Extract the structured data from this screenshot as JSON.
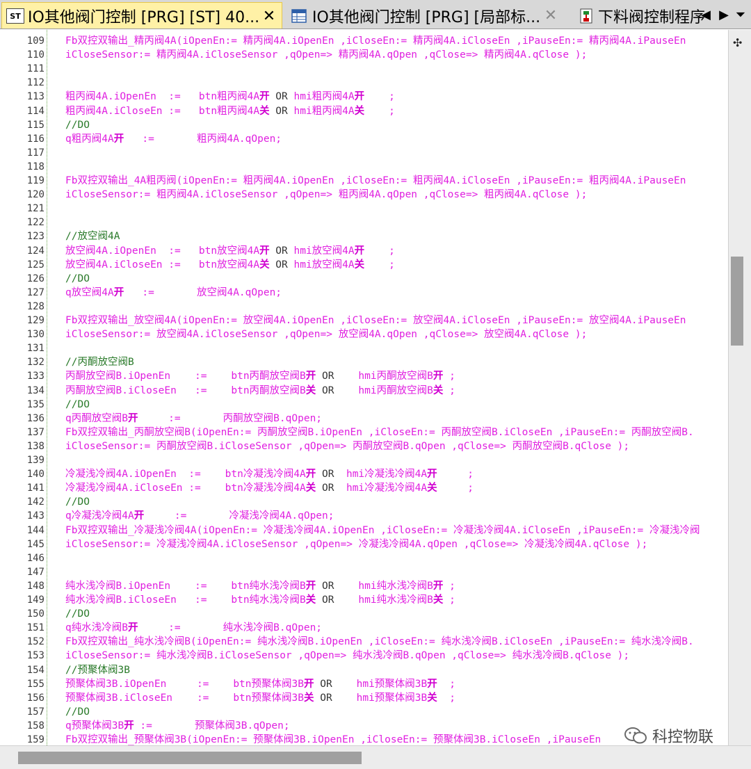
{
  "tabs": [
    {
      "title": "IO其他阀门控制 [PRG] [ST] 40...",
      "badge": "ST",
      "active": true
    },
    {
      "title": "IO其他阀门控制 [PRG] [局部标...",
      "active": false
    },
    {
      "title": "下料阀控制程序",
      "active": false
    }
  ],
  "lines": [
    {
      "n": "109",
      "html": "Fb双控双输出_精丙阀4A(iOpenEn:= 精丙阀4A.iOpenEn ,iCloseEn:= 精丙阀4A.iCloseEn ,iPauseEn:= 精丙阀4A.iPauseEn"
    },
    {
      "n": "110",
      "html": "iCloseSensor:= 精丙阀4A.iCloseSensor ,qOpen=> 精丙阀4A.qOpen ,qClose=> 精丙阀4A.qClose );"
    },
    {
      "n": "111",
      "html": ""
    },
    {
      "n": "112",
      "html": ""
    },
    {
      "n": "113",
      "html": "粗丙阀4A.iOpenEn  :=   btn粗丙阀4A<b>开</b> <span class=\"kw\">OR</span> hmi粗丙阀4A<b>开</b>    ;"
    },
    {
      "n": "114",
      "html": "粗丙阀4A.iCloseEn :=   btn粗丙阀4A<b>关</b> <span class=\"kw\">OR</span> hmi粗丙阀4A<b>关</b>    ;"
    },
    {
      "n": "115",
      "html": "<span class=\"cm\">//DO</span>"
    },
    {
      "n": "116",
      "html": "q粗丙阀4A<b>开</b>   :=       粗丙阀4A.qOpen;"
    },
    {
      "n": "117",
      "html": ""
    },
    {
      "n": "118",
      "html": ""
    },
    {
      "n": "119",
      "html": "Fb双控双输出_4A粗丙阀(iOpenEn:= 粗丙阀4A.iOpenEn ,iCloseEn:= 粗丙阀4A.iCloseEn ,iPauseEn:= 粗丙阀4A.iPauseEn"
    },
    {
      "n": "120",
      "html": "iCloseSensor:= 粗丙阀4A.iCloseSensor ,qOpen=> 粗丙阀4A.qOpen ,qClose=> 粗丙阀4A.qClose );"
    },
    {
      "n": "121",
      "html": ""
    },
    {
      "n": "122",
      "html": ""
    },
    {
      "n": "123",
      "html": "<span class=\"cm\">//放空阀4A</span>"
    },
    {
      "n": "124",
      "html": "放空阀4A.iOpenEn  :=   btn放空阀4A<b>开</b> <span class=\"kw\">OR</span> hmi放空阀4A<b>开</b>    ;"
    },
    {
      "n": "125",
      "html": "放空阀4A.iCloseEn :=   btn放空阀4A<b>关</b> <span class=\"kw\">OR</span> hmi放空阀4A<b>关</b>    ;"
    },
    {
      "n": "126",
      "html": "<span class=\"cm\">//DO</span>"
    },
    {
      "n": "127",
      "html": "q放空阀4A<b>开</b>   :=       放空阀4A.qOpen;"
    },
    {
      "n": "128",
      "html": ""
    },
    {
      "n": "129",
      "html": "Fb双控双输出_放空阀4A(iOpenEn:= 放空阀4A.iOpenEn ,iCloseEn:= 放空阀4A.iCloseEn ,iPauseEn:= 放空阀4A.iPauseEn"
    },
    {
      "n": "130",
      "html": "iCloseSensor:= 放空阀4A.iCloseSensor ,qOpen=> 放空阀4A.qOpen ,qClose=> 放空阀4A.qClose );"
    },
    {
      "n": "131",
      "html": ""
    },
    {
      "n": "132",
      "html": "<span class=\"cm\">//丙酮放空阀B</span>"
    },
    {
      "n": "133",
      "html": "丙酮放空阀B.iOpenEn    :=    btn丙酮放空阀B<b>开</b> <span class=\"kw\">OR</span>    hmi丙酮放空阀B<b>开</b> ;"
    },
    {
      "n": "134",
      "html": "丙酮放空阀B.iCloseEn   :=    btn丙酮放空阀B<b>关</b> <span class=\"kw\">OR</span>    hmi丙酮放空阀B<b>关</b> ;"
    },
    {
      "n": "135",
      "html": "<span class=\"cm\">//DO</span>"
    },
    {
      "n": "136",
      "html": "q丙酮放空阀B<b>开</b>     :=       丙酮放空阀B.qOpen;"
    },
    {
      "n": "137",
      "html": "Fb双控双输出_丙酮放空阀B(iOpenEn:= 丙酮放空阀B.iOpenEn ,iCloseEn:= 丙酮放空阀B.iCloseEn ,iPauseEn:= 丙酮放空阀B."
    },
    {
      "n": "138",
      "html": "iCloseSensor:= 丙酮放空阀B.iCloseSensor ,qOpen=> 丙酮放空阀B.qOpen ,qClose=> 丙酮放空阀B.qClose );"
    },
    {
      "n": "139",
      "html": ""
    },
    {
      "n": "140",
      "html": "冷凝浅冷阀4A.iOpenEn  :=    btn冷凝浅冷阀4A<b>开</b> <span class=\"kw\">OR</span>  hmi冷凝浅冷阀4A<b>开</b>     ;"
    },
    {
      "n": "141",
      "html": "冷凝浅冷阀4A.iCloseEn :=    btn冷凝浅冷阀4A<b>关</b> <span class=\"kw\">OR</span>  hmi冷凝浅冷阀4A<b>关</b>     ;"
    },
    {
      "n": "142",
      "html": "<span class=\"cm\">//DO</span>"
    },
    {
      "n": "143",
      "html": "q冷凝浅冷阀4A<b>开</b>     :=       冷凝浅冷阀4A.qOpen;"
    },
    {
      "n": "144",
      "html": "Fb双控双输出_冷凝浅冷阀4A(iOpenEn:= 冷凝浅冷阀4A.iOpenEn ,iCloseEn:= 冷凝浅冷阀4A.iCloseEn ,iPauseEn:= 冷凝浅冷阀"
    },
    {
      "n": "145",
      "html": "iCloseSensor:= 冷凝浅冷阀4A.iCloseSensor ,qOpen=> 冷凝浅冷阀4A.qOpen ,qClose=> 冷凝浅冷阀4A.qClose );"
    },
    {
      "n": "146",
      "html": ""
    },
    {
      "n": "147",
      "html": ""
    },
    {
      "n": "148",
      "html": "纯水浅冷阀B.iOpenEn    :=    btn纯水浅冷阀B<b>开</b> <span class=\"kw\">OR</span>    hmi纯水浅冷阀B<b>开</b> ;"
    },
    {
      "n": "149",
      "html": "纯水浅冷阀B.iCloseEn   :=    btn纯水浅冷阀B<b>关</b> <span class=\"kw\">OR</span>    hmi纯水浅冷阀B<b>关</b> ;"
    },
    {
      "n": "150",
      "html": "<span class=\"cm\">//DO</span>"
    },
    {
      "n": "151",
      "html": "q纯水浅冷阀B<b>开</b>     :=       纯水浅冷阀B.qOpen;"
    },
    {
      "n": "152",
      "html": "Fb双控双输出_纯水浅冷阀B(iOpenEn:= 纯水浅冷阀B.iOpenEn ,iCloseEn:= 纯水浅冷阀B.iCloseEn ,iPauseEn:= 纯水浅冷阀B."
    },
    {
      "n": "153",
      "html": "iCloseSensor:= 纯水浅冷阀B.iCloseSensor ,qOpen=> 纯水浅冷阀B.qOpen ,qClose=> 纯水浅冷阀B.qClose );"
    },
    {
      "n": "154",
      "html": "<span class=\"cm\">//预聚体阀3B</span>"
    },
    {
      "n": "155",
      "html": "预聚体阀3B.iOpenEn     :=    btn预聚体阀3B<b>开</b> <span class=\"kw\">OR</span>    hmi预聚体阀3B<b>开</b>  ;"
    },
    {
      "n": "156",
      "html": "预聚体阀3B.iCloseEn    :=    btn预聚体阀3B<b>关</b> <span class=\"kw\">OR</span>    hmi预聚体阀3B<b>关</b>  ;"
    },
    {
      "n": "157",
      "html": "<span class=\"cm\">//DO</span>"
    },
    {
      "n": "158",
      "html": "q预聚体阀3B<b>开</b> :=       预聚体阀3B.qOpen;"
    },
    {
      "n": "159",
      "html": "Fb双控双输出_预聚体阀3B(iOpenEn:= 预聚体阀3B.iOpenEn ,iCloseEn:= 预聚体阀3B.iCloseEn ,iPauseEn"
    }
  ],
  "watermark": {
    "text": "科控物联"
  },
  "icons": {
    "close_active": "close-icon",
    "close_inactive": "close-icon",
    "scroll_left": "chevron-left-icon",
    "scroll_right": "chevron-right-icon",
    "dropdown": "chevron-down-icon",
    "split": "plus-icon"
  },
  "colors": {
    "code_text": "#e020e0",
    "comment": "#2a7a2a",
    "active_tab": "#fff1a6"
  }
}
